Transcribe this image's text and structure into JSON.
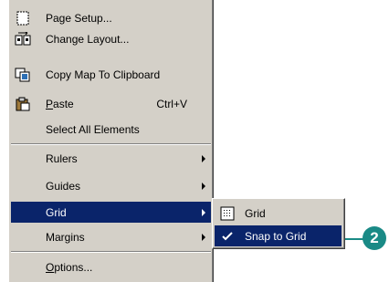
{
  "menu": {
    "items": [
      {
        "icon": "page-setup-icon",
        "label": "Page Setup..."
      },
      {
        "icon": "change-layout-icon",
        "label": "Change Layout..."
      },
      {
        "icon": "copy-map-icon",
        "label": "Copy Map To Clipboard"
      },
      {
        "icon": "paste-icon",
        "label_underlined": "P",
        "label_rest": "aste",
        "shortcut": "Ctrl+V"
      },
      {
        "label": "Select All Elements"
      },
      {
        "label": "Rulers"
      },
      {
        "label": "Guides"
      },
      {
        "label": "Grid",
        "selected": true
      },
      {
        "label": "Margins"
      },
      {
        "label_underlined": "O",
        "label_rest": "ptions..."
      }
    ]
  },
  "submenu": {
    "items": [
      {
        "icon": "grid-icon",
        "label": "Grid"
      },
      {
        "icon": "checkmark-icon",
        "label": "Snap to Grid",
        "selected": true
      }
    ]
  },
  "callout": {
    "number": "2",
    "color": "#1a8a86"
  },
  "colors": {
    "menu_bg": "#d4d0c8",
    "highlight": "#0a246a"
  }
}
